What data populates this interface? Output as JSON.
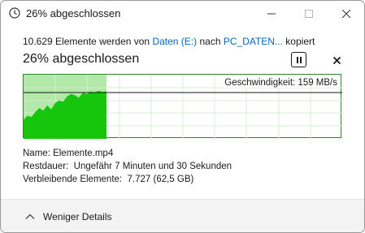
{
  "window": {
    "title": "26% abgeschlossen",
    "title_icon": "clock-icon",
    "controls": {
      "minimize_icon": "minimize-icon",
      "maximize_icon": "maximize-icon",
      "close_icon": "close-icon"
    }
  },
  "copy": {
    "prefix": "10.629 Elemente werden von ",
    "source": "Daten (E:)",
    "middle": " nach ",
    "destination": "PC_DATEN...",
    "suffix": " kopiert"
  },
  "progress": {
    "title": "26% abgeschlossen",
    "percent": 26,
    "pause_icon": "pause-icon",
    "cancel_icon": "cancel-icon"
  },
  "graph": {
    "speed_label": "Geschwindigkeit: 159 MB/s",
    "colors": {
      "filled_area": "#16c60c",
      "progress_background": "#b2e8a8",
      "grid": "#d8ecd5",
      "border": "#2a8a2a",
      "speed_line": "#1a1a1a"
    }
  },
  "details": {
    "name_label": "Name:",
    "name_value": "Elemente.mp4",
    "remaining_time_label": "Restdauer:",
    "remaining_time_value": "Ungefähr 7 Minuten und 30 Sekunden",
    "remaining_items_label": "Verbleibende Elemente:",
    "remaining_items_value": "7.727 (62,5 GB)"
  },
  "footer": {
    "less_details_label": "Weniger Details",
    "chevron_icon": "chevron-up-icon"
  }
}
